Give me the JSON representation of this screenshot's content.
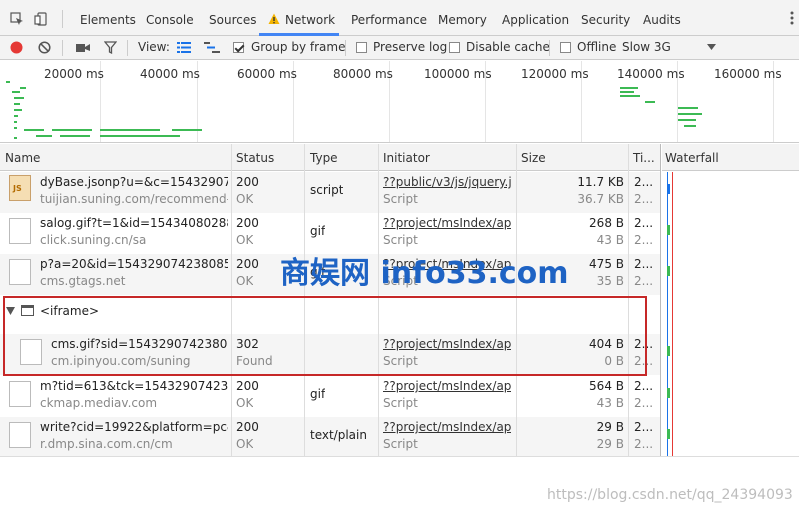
{
  "tabs": [
    {
      "label": "Elements"
    },
    {
      "label": "Console"
    },
    {
      "label": "Sources"
    },
    {
      "label": "Network"
    },
    {
      "label": "Performance"
    },
    {
      "label": "Memory"
    },
    {
      "label": "Application"
    },
    {
      "label": "Security"
    },
    {
      "label": "Audits"
    }
  ],
  "toolbar": {
    "view_label": "View:",
    "group_by_frame": "Group by frame",
    "preserve_log": "Preserve log",
    "disable_cache": "Disable cache",
    "offline": "Offline",
    "throttle": "Slow 3G"
  },
  "overview": {
    "ticks": [
      "20000 ms",
      "40000 ms",
      "60000 ms",
      "80000 ms",
      "100000 ms",
      "120000 ms",
      "140000 ms",
      "160000 ms"
    ]
  },
  "columns": [
    "Name",
    "Status",
    "Type",
    "Initiator",
    "Size",
    "Ti...",
    "Waterfall"
  ],
  "rows": [
    {
      "name": "dyBase.jsonp?u=&c=1543290742...",
      "domain": "tuijian.suning.com/recommend-p...",
      "status": "200",
      "status_text": "OK",
      "type": "script",
      "initiator": "??public/v3/js/jquery.j...",
      "initiator_type": "Script",
      "size": "11.7 KB",
      "size2": "36.7 KB",
      "time": "2...",
      "time2": "2..."
    },
    {
      "name": "salog.gif?t=1&id=154340802886...",
      "domain": "click.suning.cn/sa",
      "status": "200",
      "status_text": "OK",
      "type": "gif",
      "initiator": "??project/msIndex/api...",
      "initiator_type": "Script",
      "size": "268 B",
      "size2": "43 B",
      "time": "2...",
      "time2": "2..."
    },
    {
      "name": "p?a=20&id=1543290742380855...",
      "domain": "cms.gtags.net",
      "status": "200",
      "status_text": "OK",
      "type": "gif",
      "initiator": "??project/msIndex/api...",
      "initiator_type": "Script",
      "size": "475 B",
      "size2": "35 B",
      "time": "2...",
      "time2": "2..."
    }
  ],
  "iframe_group": {
    "label": "<iframe>",
    "row": {
      "name": "cms.gif?sid=154329074238085...",
      "domain": "cm.ipinyou.com/suning",
      "status": "302",
      "status_text": "Found",
      "type": "",
      "initiator": "??project/msIndex/api...",
      "initiator_type": "Script",
      "size": "404 B",
      "size2": "0 B",
      "time": "2...",
      "time2": "2..."
    }
  },
  "rows_after": [
    {
      "name": "m?tid=613&tck=1543290742380...",
      "domain": "ckmap.mediav.com",
      "status": "200",
      "status_text": "OK",
      "type": "gif",
      "initiator": "??project/msIndex/api...",
      "initiator_type": "Script",
      "size": "564 B",
      "size2": "43 B",
      "time": "2...",
      "time2": "2..."
    },
    {
      "name": "write?cid=19922&platform=pc&s...",
      "domain": "r.dmp.sina.com.cn/cm",
      "status": "200",
      "status_text": "OK",
      "type": "text/plain",
      "initiator": "??project/msIndex/api...",
      "initiator_type": "Script",
      "size": "29 B",
      "size2": "29 B",
      "time": "2...",
      "time2": "2..."
    }
  ],
  "watermark": "商娱网 info33.com",
  "csdn_watermark": "https://blog.csdn.net/qq_24394093",
  "colors": {
    "accent": "#4285f4",
    "record": "#e53935",
    "bar_green": "#3cba54",
    "highlight": "#c62828"
  }
}
